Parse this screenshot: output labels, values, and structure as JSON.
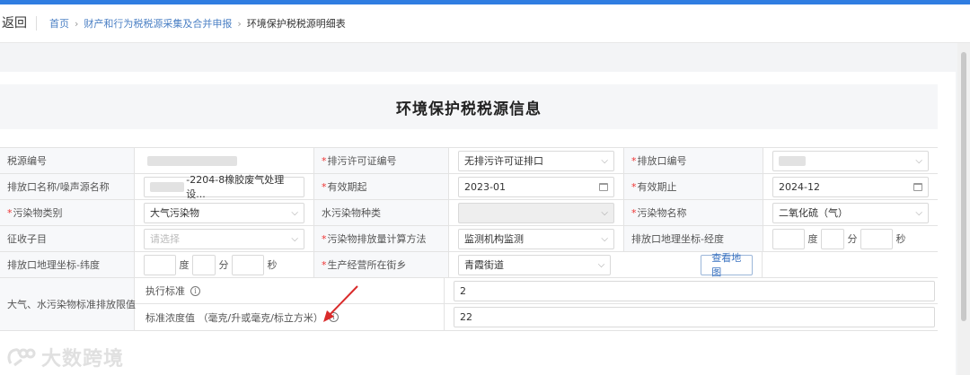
{
  "header": {
    "back_label": "返回",
    "breadcrumb": [
      "首页",
      "财产和行为税税源采集及合并申报",
      "环境保护税税源明细表"
    ],
    "sep": "›"
  },
  "page_title": "环境保护税税源信息",
  "form": {
    "source_no_label": "税源编号",
    "permit_no_label": "排污许可证编号",
    "permit_no_value": "无排污许可证排口",
    "outlet_no_label": "排放口编号",
    "outlet_name_label": "排放口名称/噪声源名称",
    "outlet_name_value": "-2204-8橡胶废气处理设...",
    "valid_from_label": "有效期起",
    "valid_from_value": "2023-01",
    "valid_to_label": "有效期止",
    "valid_to_value": "2024-12",
    "pollutant_category_label": "污染物类别",
    "pollutant_category_value": "大气污染物",
    "water_pollutant_type_label": "水污染物种类",
    "pollutant_name_label": "污染物名称",
    "pollutant_name_value": "二氧化硫（气）",
    "levy_item_label": "征收子目",
    "levy_item_placeholder": "请选择",
    "calc_method_label": "污染物排放量计算方法",
    "calc_method_value": "监测机构监测",
    "longitude_label": "排放口地理坐标-经度",
    "latitude_label": "排放口地理坐标-纬度",
    "unit_degree": "度",
    "unit_minute": "分",
    "unit_second": "秒",
    "street_label": "生产经营所在街乡",
    "street_value": "青霞街道",
    "map_button": "查看地图",
    "limits_label": "大气、水污染物标准排放限值",
    "standard_label": "执行标准",
    "standard_value": "2",
    "concentration_label": "标准浓度值 （毫克/升或毫克/标立方米）",
    "concentration_value": "22",
    "required_mark": "*"
  },
  "watermark": "大数跨境",
  "icons": {
    "select": "chevron-down-icon",
    "date": "calendar-icon",
    "info": "info-icon"
  },
  "colors": {
    "accent": "#2f7de1",
    "link": "#4a7fc4",
    "required": "#e33333",
    "annotation_arrow": "#d92b2b"
  }
}
